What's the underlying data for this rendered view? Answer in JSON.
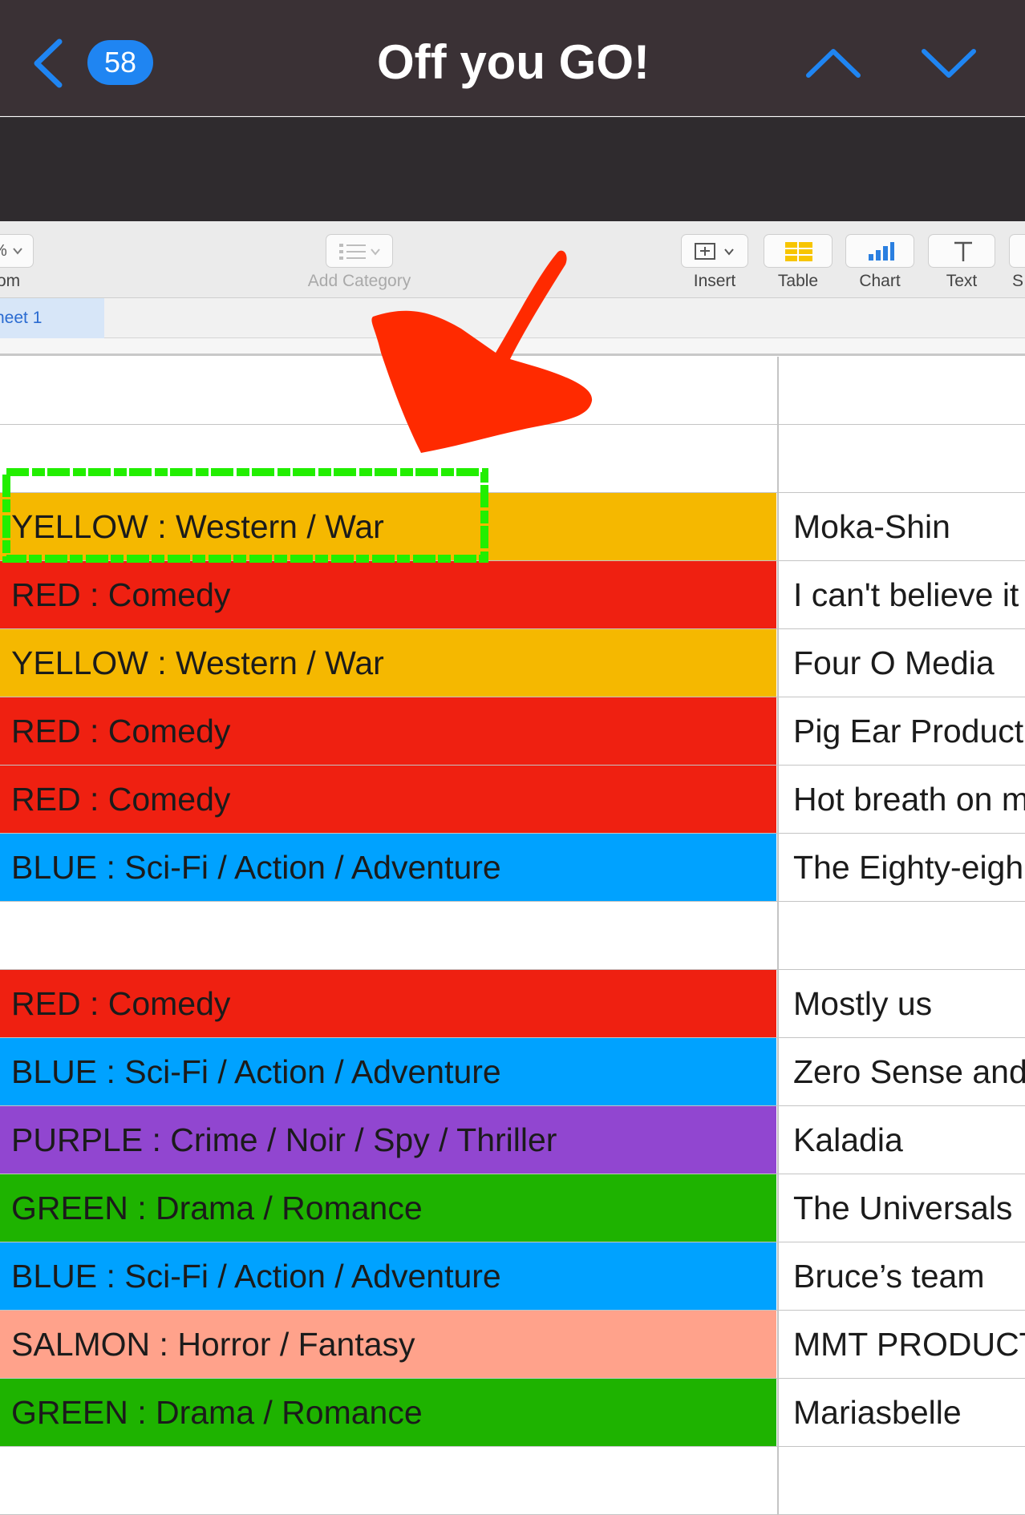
{
  "mail": {
    "title": "Off you GO!",
    "unread_count": "58",
    "icons": {
      "back": "chevron-left-icon",
      "previous": "chevron-up-icon",
      "next": "chevron-down-icon"
    },
    "colors": {
      "header_bg": "#3a3135",
      "accent": "#1f85f2"
    }
  },
  "toolbar": {
    "zoom_label": "om",
    "zoom_value": "%",
    "add_category_label": "Add Category",
    "insert_label": "Insert",
    "table_label": "Table",
    "chart_label": "Chart",
    "text_label": "Text",
    "shape_label": "S"
  },
  "sheet": {
    "tab_label": "heet 1"
  },
  "rows": [
    {
      "category": "",
      "name": "",
      "color": "#ffffff"
    },
    {
      "category": "",
      "name": "",
      "color": "#ffffff"
    },
    {
      "category": "YELLOW : Western / War",
      "name": "Moka-Shin",
      "color": "#f5b800"
    },
    {
      "category": "RED : Comedy",
      "name": "I can't believe it",
      "color": "#ef2011"
    },
    {
      "category": "YELLOW : Western / War",
      "name": "Four O Media",
      "color": "#f5b800"
    },
    {
      "category": "RED : Comedy",
      "name": "Pig Ear Product",
      "color": "#ef2011"
    },
    {
      "category": "RED : Comedy",
      "name": "Hot breath on m",
      "color": "#ef2011"
    },
    {
      "category": "BLUE : Sci-Fi / Action / Adventure",
      "name": "The Eighty-eigh",
      "color": "#00a2ff"
    },
    {
      "category": "",
      "name": "",
      "color": "#ffffff"
    },
    {
      "category": "RED : Comedy",
      "name": "Mostly us",
      "color": "#ef2011"
    },
    {
      "category": "BLUE : Sci-Fi / Action / Adventure",
      "name": "Zero Sense and",
      "color": "#00a2ff"
    },
    {
      "category": "PURPLE : Crime / Noir / Spy / Thriller",
      "name": "Kaladia",
      "color": "#9146d0"
    },
    {
      "category": "GREEN : Drama / Romance",
      "name": "The Universals",
      "color": "#1eb300"
    },
    {
      "category": "BLUE : Sci-Fi / Action / Adventure",
      "name": "Bruce’s team",
      "color": "#00a2ff"
    },
    {
      "category": "SALMON : Horror / Fantasy",
      "name": "MMT PRODUCT",
      "color": "#ffa28b"
    },
    {
      "category": "GREEN : Drama / Romance",
      "name": "Mariasbelle",
      "color": "#1eb300"
    },
    {
      "category": "",
      "name": "",
      "color": "#ffffff"
    }
  ],
  "annotations": {
    "arrow_color": "#ff2a00",
    "highlight_color": "#22ee00"
  }
}
